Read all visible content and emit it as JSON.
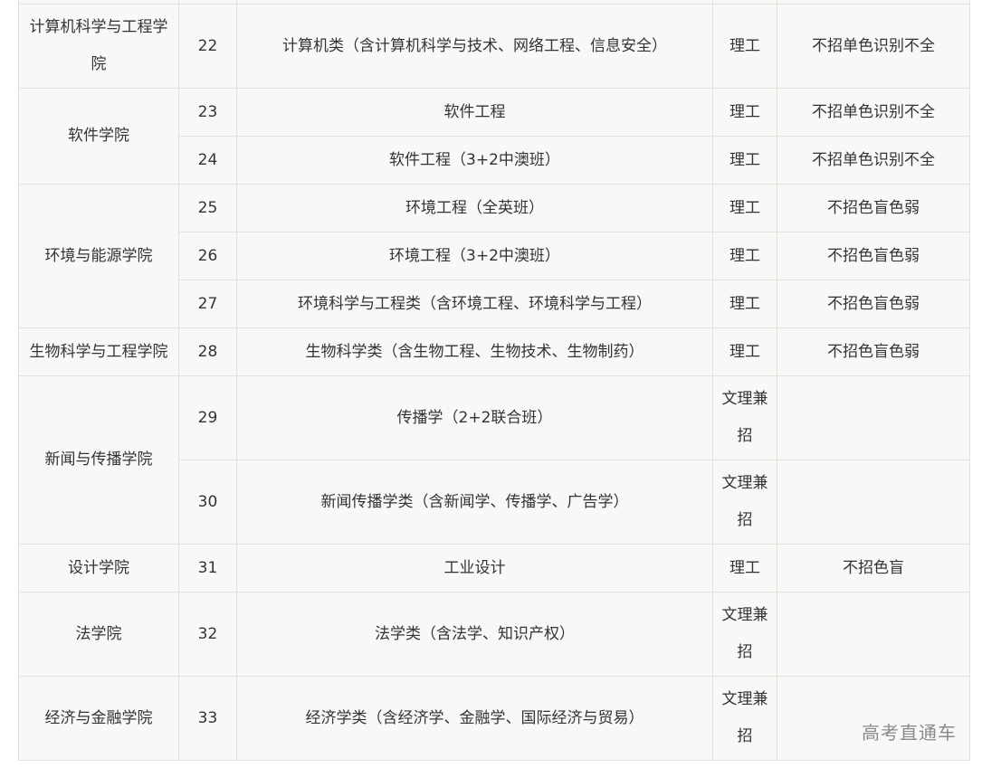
{
  "rows": [
    {
      "college": "",
      "no": "",
      "major": "",
      "category": "",
      "restriction": ""
    },
    {
      "college": "计算机科学与工程学院",
      "no": "22",
      "major": "计算机类（含计算机科学与技术、网络工程、信息安全）",
      "category": "理工",
      "restriction": "不招单色识别不全"
    },
    {
      "college": "软件学院",
      "no": "23",
      "major": "软件工程",
      "category": "理工",
      "restriction": "不招单色识别不全"
    },
    {
      "college": "",
      "no": "24",
      "major": "软件工程（3+2中澳班）",
      "category": "理工",
      "restriction": "不招单色识别不全"
    },
    {
      "college": "环境与能源学院",
      "no": "25",
      "major": "环境工程（全英班）",
      "category": "理工",
      "restriction": "不招色盲色弱"
    },
    {
      "college": "",
      "no": "26",
      "major": "环境工程（3+2中澳班）",
      "category": "理工",
      "restriction": "不招色盲色弱"
    },
    {
      "college": "",
      "no": "27",
      "major": "环境科学与工程类（含环境工程、环境科学与工程）",
      "category": "理工",
      "restriction": "不招色盲色弱"
    },
    {
      "college": "生物科学与工程学院",
      "no": "28",
      "major": "生物科学类（含生物工程、生物技术、生物制药）",
      "category": "理工",
      "restriction": "不招色盲色弱"
    },
    {
      "college": "新闻与传播学院",
      "no": "29",
      "major": "传播学（2+2联合班）",
      "category": "文理兼招",
      "restriction": ""
    },
    {
      "college": "",
      "no": "30",
      "major": "新闻传播学类（含新闻学、传播学、广告学）",
      "category": "文理兼招",
      "restriction": ""
    },
    {
      "college": "设计学院",
      "no": "31",
      "major": "工业设计",
      "category": "理工",
      "restriction": "不招色盲"
    },
    {
      "college": "法学院",
      "no": "32",
      "major": "法学类（含法学、知识产权）",
      "category": "文理兼招",
      "restriction": ""
    },
    {
      "college": "经济与金融学院",
      "no": "33",
      "major": "经济学类（含经济学、金融学、国际经济与贸易）",
      "category": "文理兼招",
      "restriction": ""
    }
  ],
  "watermark": "高考直通车"
}
